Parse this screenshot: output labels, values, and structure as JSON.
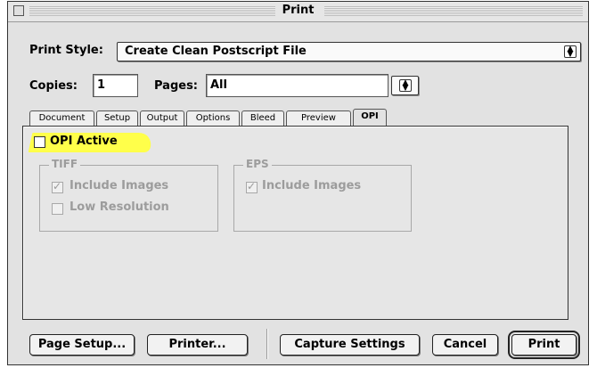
{
  "window": {
    "title": "Print"
  },
  "print_style": {
    "label": "Print Style:",
    "value": "Create Clean Postscript File"
  },
  "copies": {
    "label": "Copies:",
    "value": "1"
  },
  "pages": {
    "label": "Pages:",
    "value": "All"
  },
  "tabs": [
    {
      "label": "Document",
      "active": false
    },
    {
      "label": "Setup",
      "active": false
    },
    {
      "label": "Output",
      "active": false
    },
    {
      "label": "Options",
      "active": false
    },
    {
      "label": "Bleed",
      "active": false
    },
    {
      "label": "Preview",
      "active": false
    },
    {
      "label": "OPI",
      "active": true
    }
  ],
  "opi": {
    "active_label": "OPI Active",
    "active_checked": false,
    "highlight_color": "#ffff4a",
    "tiff": {
      "title": "TIFF",
      "include_images": {
        "label": "Include Images",
        "checked": true
      },
      "low_resolution": {
        "label": "Low Resolution",
        "checked": false
      }
    },
    "eps": {
      "title": "EPS",
      "include_images": {
        "label": "Include Images",
        "checked": true
      }
    }
  },
  "buttons": {
    "page_setup": "Page Setup...",
    "printer": "Printer...",
    "capture_settings": "Capture Settings",
    "cancel": "Cancel",
    "print": "Print"
  },
  "icons": {
    "popup_arrows": "updown-arrows-icon",
    "checkmark": "check-icon"
  }
}
